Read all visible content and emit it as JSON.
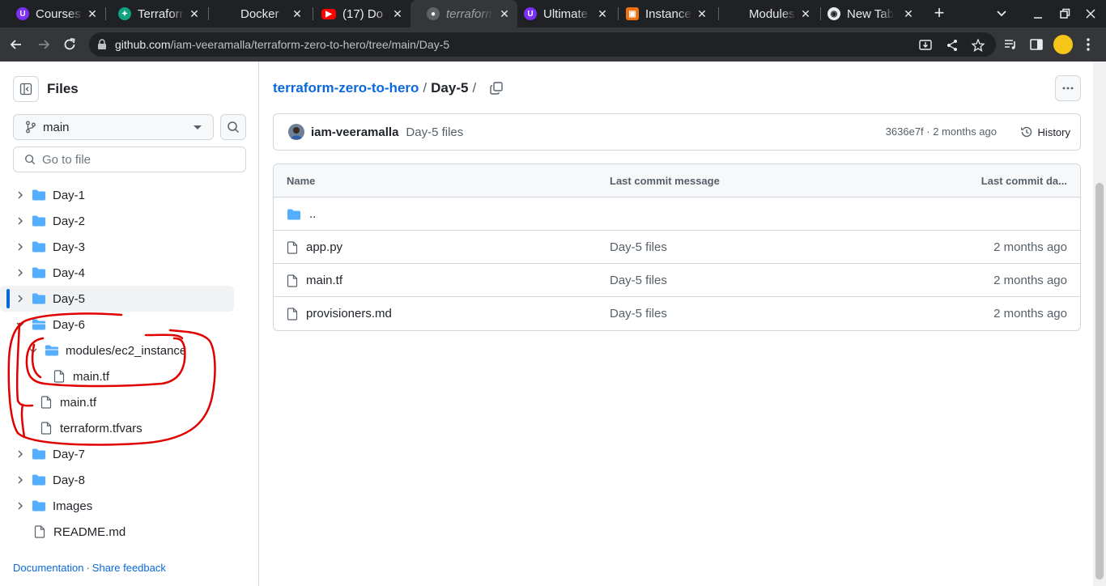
{
  "browser": {
    "tabs": [
      {
        "title": "Courses",
        "favicon_color": "#7b2ff7",
        "active": false
      },
      {
        "title": "Terraform",
        "favicon_color": "#10a37f",
        "active": false
      },
      {
        "title": "Docker",
        "favicon_color": "#202124",
        "active": false
      },
      {
        "title": "(17) Do",
        "favicon_color": "#ff0000",
        "active": false
      },
      {
        "title": "terraform",
        "favicon_color": "#5f6368",
        "active": true
      },
      {
        "title": "Ultimate",
        "favicon_color": "#7b2ff7",
        "active": false
      },
      {
        "title": "Instance",
        "favicon_color": "#ec7211",
        "active": false
      },
      {
        "title": "Modules",
        "favicon_color": "#202124",
        "active": false
      },
      {
        "title": "New Tab",
        "favicon_color": "#e8eaed",
        "active": false
      }
    ],
    "new_tab_label": "+",
    "url_domain": "github.com",
    "url_path": "/iam-veeramalla/terraform-zero-to-hero/tree/main/Day-5"
  },
  "sidebar": {
    "title": "Files",
    "branch": "main",
    "goto_placeholder": "Go to file",
    "tree": [
      {
        "label": "Day-1",
        "type": "folder",
        "depth": 0,
        "expanded": false
      },
      {
        "label": "Day-2",
        "type": "folder",
        "depth": 0,
        "expanded": false
      },
      {
        "label": "Day-3",
        "type": "folder",
        "depth": 0,
        "expanded": false
      },
      {
        "label": "Day-4",
        "type": "folder",
        "depth": 0,
        "expanded": false
      },
      {
        "label": "Day-5",
        "type": "folder",
        "depth": 0,
        "expanded": false,
        "selected": true
      },
      {
        "label": "Day-6",
        "type": "folder",
        "depth": 0,
        "expanded": true
      },
      {
        "label": "modules/ec2_instance",
        "type": "folder",
        "depth": 1,
        "expanded": true
      },
      {
        "label": "main.tf",
        "type": "file",
        "depth": 2
      },
      {
        "label": "main.tf",
        "type": "file",
        "depth": 1
      },
      {
        "label": "terraform.tfvars",
        "type": "file",
        "depth": 1
      },
      {
        "label": "Day-7",
        "type": "folder",
        "depth": 0,
        "expanded": false
      },
      {
        "label": "Day-8",
        "type": "folder",
        "depth": 0,
        "expanded": false
      },
      {
        "label": "Images",
        "type": "folder",
        "depth": 0,
        "expanded": false
      },
      {
        "label": "README.md",
        "type": "file",
        "depth": 0
      }
    ],
    "footer": {
      "documentation": "Documentation",
      "separator": "·",
      "feedback": "Share feedback"
    }
  },
  "main": {
    "breadcrumb": {
      "repo": "terraform-zero-to-hero",
      "sep": "/",
      "current": "Day-5",
      "trailing": "/"
    },
    "commit": {
      "author": "iam-veeramalla",
      "message": "Day-5 files",
      "meta": "3636e7f · 2 months ago",
      "history_label": "History"
    },
    "table": {
      "headers": {
        "name": "Name",
        "message": "Last commit message",
        "date": "Last commit da..."
      },
      "parent_label": "..",
      "rows": [
        {
          "name": "app.py",
          "message": "Day-5 files",
          "date": "2 months ago"
        },
        {
          "name": "main.tf",
          "message": "Day-5 files",
          "date": "2 months ago"
        },
        {
          "name": "provisioners.md",
          "message": "Day-5 files",
          "date": "2 months ago"
        }
      ]
    }
  },
  "colors": {
    "link": "#0969da",
    "folder": "#54aeff",
    "annotation": "#e00000",
    "chrome_dark": "#202124",
    "chrome_toolbar": "#35363a"
  }
}
